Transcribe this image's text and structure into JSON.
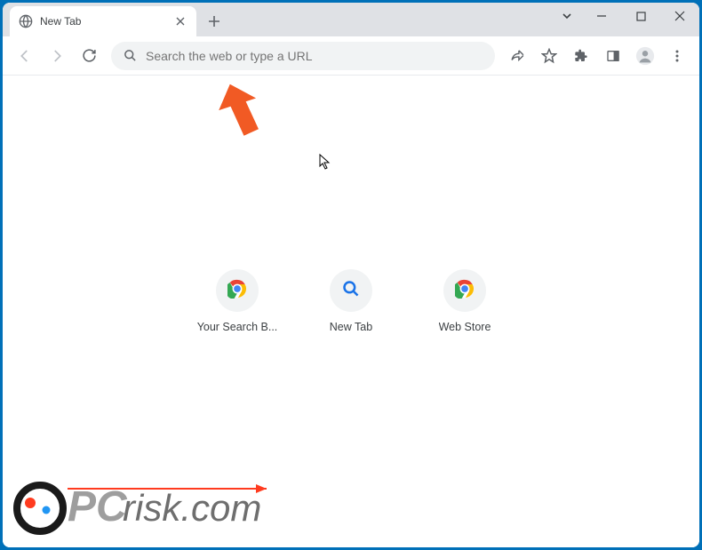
{
  "window": {
    "tab_title": "New Tab"
  },
  "toolbar": {
    "omnibox_placeholder": "Search the web or type a URL"
  },
  "shortcuts": [
    {
      "label": "Your Search B...",
      "icon": "chrome"
    },
    {
      "label": "New Tab",
      "icon": "search"
    },
    {
      "label": "Web Store",
      "icon": "chrome"
    }
  ],
  "watermark": {
    "text_prefix": "PC",
    "text_suffix": "risk.com"
  },
  "colors": {
    "frame": "#0070b8",
    "accent_orange": "#f15a24",
    "toolbar_bg": "#f1f3f4"
  }
}
